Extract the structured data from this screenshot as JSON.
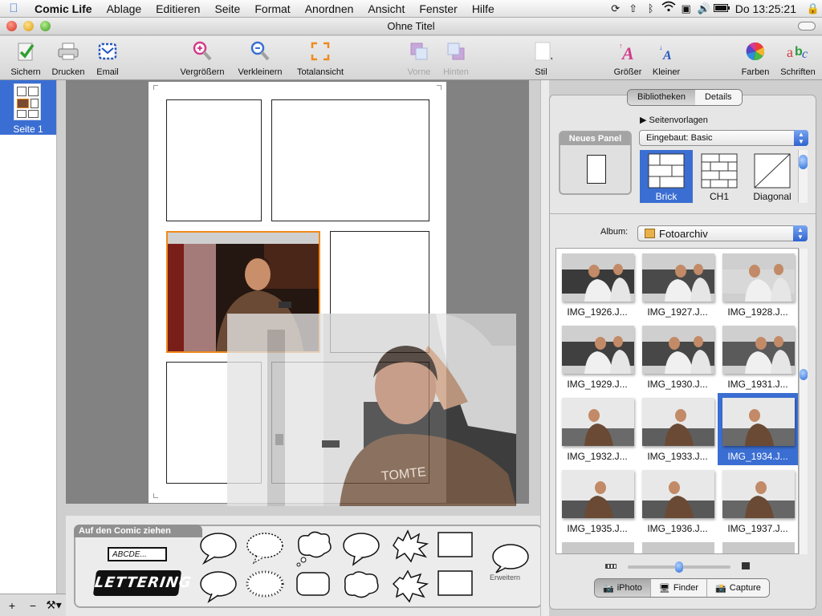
{
  "menubar": {
    "items": [
      "Comic Life",
      "Ablage",
      "Editieren",
      "Seite",
      "Format",
      "Anordnen",
      "Ansicht",
      "Fenster",
      "Hilfe"
    ],
    "clock": "Do 13:25:21"
  },
  "window": {
    "title": "Ohne Titel"
  },
  "toolbar": {
    "save": "Sichern",
    "print": "Drucken",
    "email": "Email",
    "zoom_in": "Vergrößern",
    "zoom_out": "Verkleinern",
    "fit": "Totalansicht",
    "front": "Vorne",
    "back": "Hinten",
    "style": "Stil",
    "bigger": "Größer",
    "smaller": "Kleiner",
    "colors": "Farben",
    "fonts": "Schriften"
  },
  "sidebar": {
    "page_label": "Seite 1"
  },
  "balloons": {
    "tab": "Auf den Comic ziehen",
    "text_field": "ABCDE...",
    "lettering": "LETTERING",
    "expand": "Erweitern"
  },
  "library": {
    "tabs": [
      "Bibliotheken",
      "Details"
    ],
    "new_panel": "Neues Panel",
    "templates_label": "Seitenvorlagen",
    "template_set": "Eingebaut: Basic",
    "templates": [
      "Brick",
      "CH1",
      "Diagonal"
    ],
    "album_label": "Album:",
    "album": "Fotoarchiv",
    "photos": [
      "IMG_1926.J...",
      "IMG_1927.J...",
      "IMG_1928.J...",
      "IMG_1929.J...",
      "IMG_1930.J...",
      "IMG_1931.J...",
      "IMG_1932.J...",
      "IMG_1933.J...",
      "IMG_1934.J...",
      "IMG_1935.J...",
      "IMG_1936.J...",
      "IMG_1937.J..."
    ],
    "selected_photo": "IMG_1934.J...",
    "sources": [
      "iPhoto",
      "Finder",
      "Capture"
    ],
    "selected_source": "iPhoto"
  }
}
